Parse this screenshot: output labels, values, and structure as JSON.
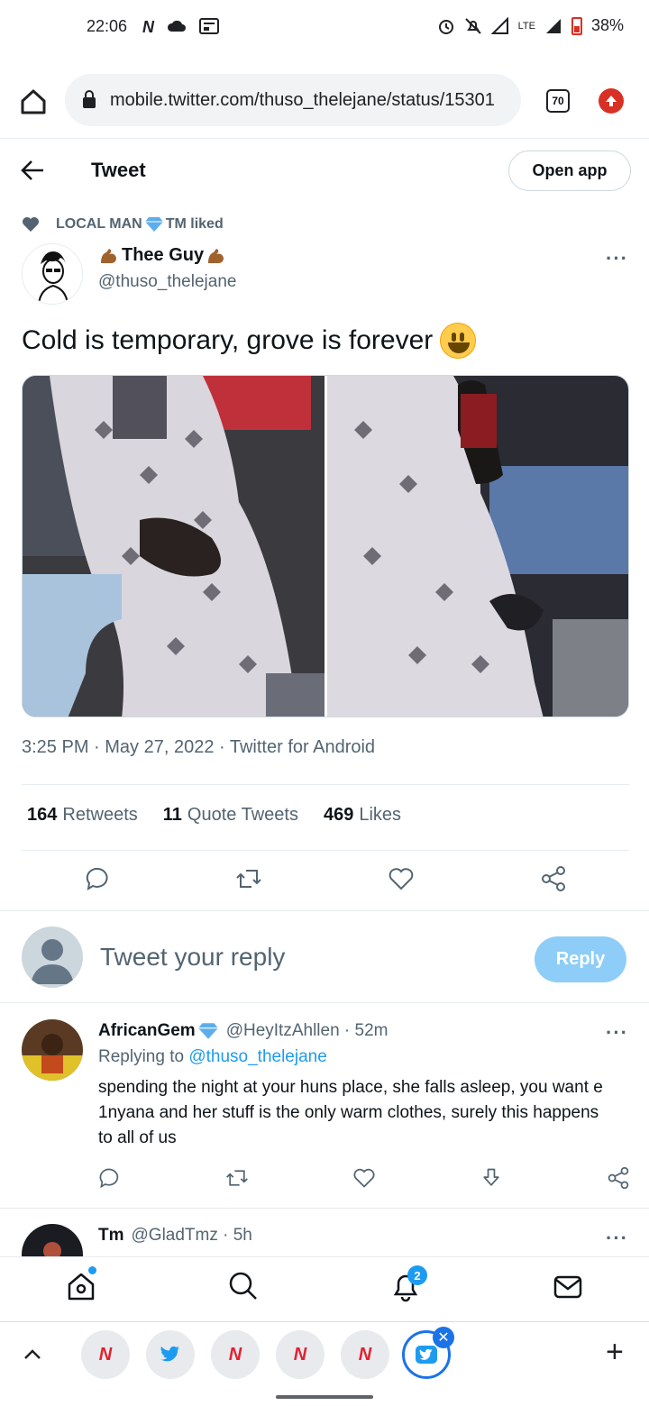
{
  "status_bar": {
    "time": "22:06",
    "left_icons": [
      "N",
      "cloud-icon",
      "news-icon"
    ],
    "network": "LTE",
    "battery_percent": "38%",
    "battery_level": 0.38
  },
  "browser": {
    "url": "mobile.twitter.com/thuso_thelejane/status/15301",
    "tab_count": "70"
  },
  "header": {
    "title": "Tweet",
    "open_app_label": "Open app"
  },
  "tweet": {
    "social_context": "LOCAL MAN",
    "social_context_suffix": "TM liked",
    "author_name": "Thee Guy",
    "author_handle": "@thuso_thelejane",
    "text": "Cold is temporary, grove is forever",
    "timestamp": "3:25 PM · May 27, 2022 · Twitter for Android",
    "stats": {
      "retweets_count": "164",
      "retweets_label": "Retweets",
      "quotes_count": "11",
      "quotes_label": "Quote Tweets",
      "likes_count": "469",
      "likes_label": "Likes"
    }
  },
  "composer": {
    "placeholder": "Tweet your reply",
    "reply_label": "Reply"
  },
  "replies": [
    {
      "name": "AfricanGem",
      "handle": "@HeyItzAhllen · 52m",
      "replying_to_label": "Replying to",
      "replying_to": "@thuso_thelejane",
      "text": "spending the night at your huns place, she falls asleep, you want e 1nyana and her stuff is the only warm clothes, surely this happens to all of us"
    },
    {
      "name": "Tm",
      "handle": "@GladTmz · 5h"
    }
  ],
  "bottom_nav": {
    "notifications_badge": "2"
  },
  "tab_strip": {
    "chips": [
      "N",
      "twitter",
      "N",
      "N",
      "N",
      "twitter"
    ],
    "plus": "+"
  },
  "colors": {
    "accent": "#1d9bf0",
    "reply_button": "#8ecdf8",
    "text_secondary": "#536471",
    "update_badge": "#d93025"
  }
}
